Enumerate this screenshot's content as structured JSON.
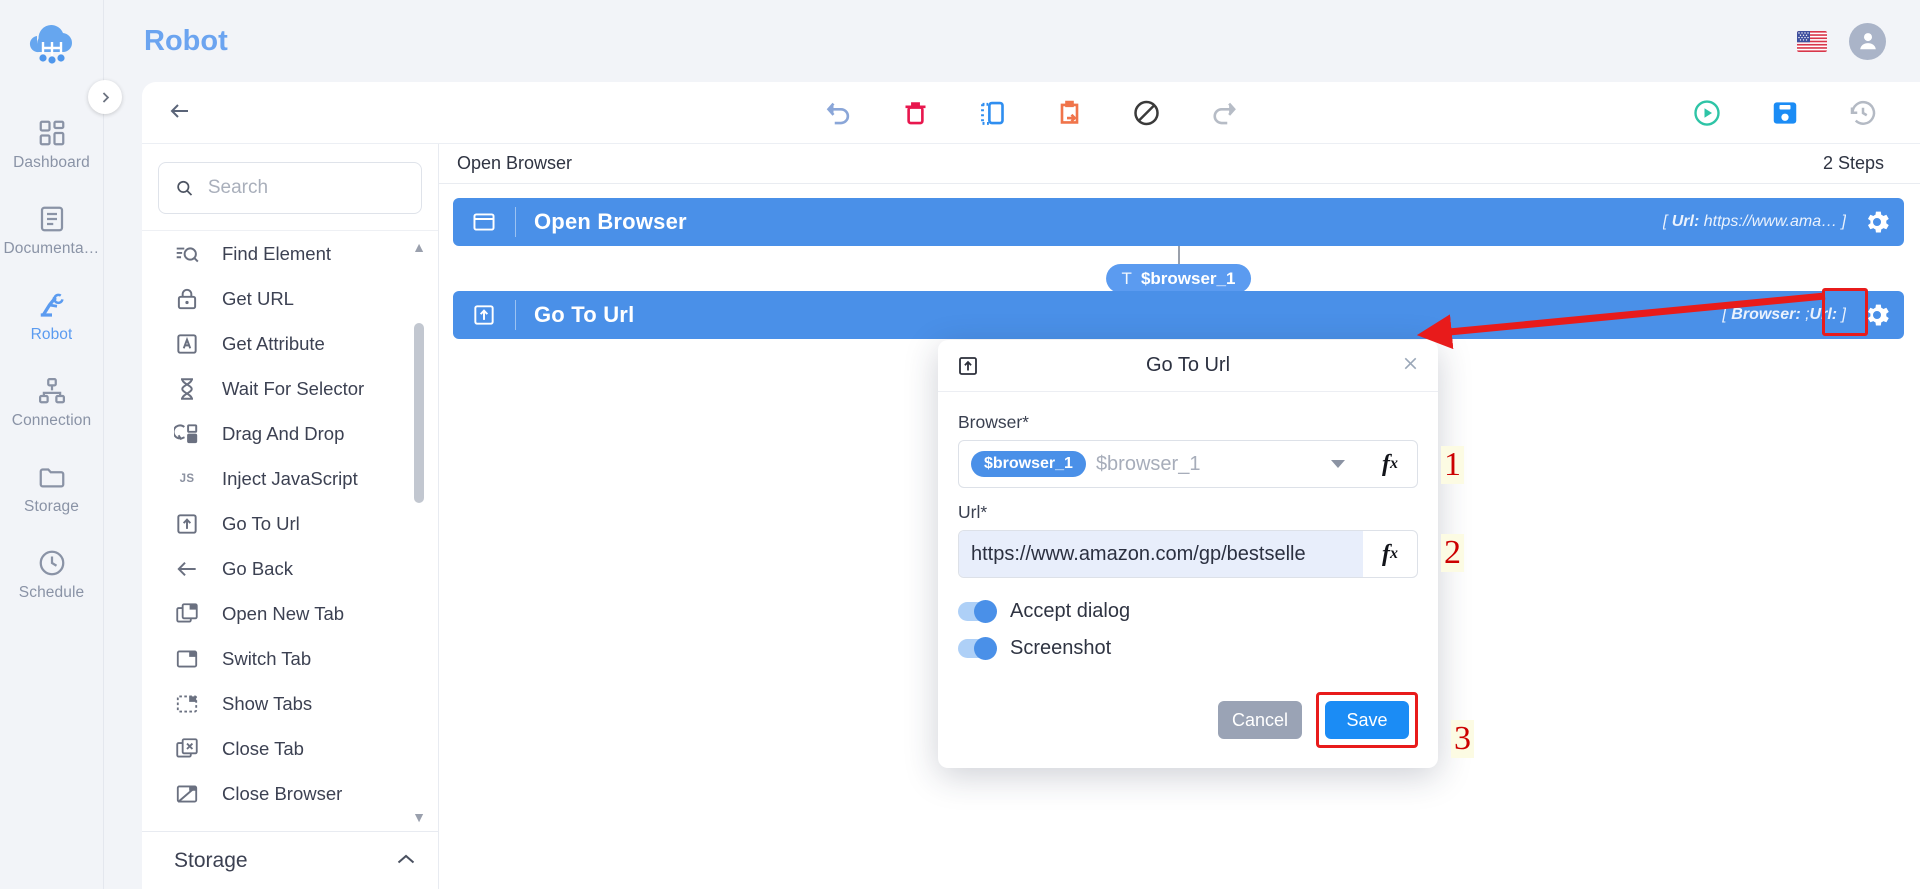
{
  "app": {
    "title": "Robot"
  },
  "rail": {
    "logo_icon": "cloud-robot-logo",
    "expand_icon": "chevron-right-icon",
    "items": [
      {
        "label": "Dashboard",
        "icon": "dashboard-grid-icon",
        "active": false
      },
      {
        "label": "Documentati...",
        "icon": "document-icon",
        "active": false
      },
      {
        "label": "Robot",
        "icon": "robot-arm-icon",
        "active": true
      },
      {
        "label": "Connection",
        "icon": "connection-tree-icon",
        "active": false
      },
      {
        "label": "Storage",
        "icon": "folder-icon",
        "active": false
      },
      {
        "label": "Schedule",
        "icon": "clock-icon",
        "active": false
      }
    ]
  },
  "header": {
    "flag_icon": "us-flag-icon",
    "avatar_icon": "user-avatar-icon"
  },
  "toolbar": {
    "back_icon": "arrow-left-icon",
    "center_actions": [
      {
        "name": "undo",
        "icon": "undo-icon",
        "color": "#8aa6d8"
      },
      {
        "name": "delete",
        "icon": "trash-icon",
        "color": "#e8174e"
      },
      {
        "name": "copy",
        "icon": "copy-dashed-icon",
        "color": "#2f8ef0"
      },
      {
        "name": "paste",
        "icon": "clipboard-arrow-icon",
        "color": "#f0744a"
      },
      {
        "name": "disable",
        "icon": "no-entry-icon",
        "color": "#3a3a3a"
      },
      {
        "name": "redo",
        "icon": "redo-icon",
        "color": "#b6bcc6"
      }
    ],
    "right_actions": [
      {
        "name": "run",
        "icon": "play-circle-icon",
        "color": "#2ec4a6"
      },
      {
        "name": "save",
        "icon": "floppy-save-icon",
        "color": "#1b8cf5"
      },
      {
        "name": "history",
        "icon": "history-clock-icon",
        "color": "#b4bac4"
      }
    ]
  },
  "actions_panel": {
    "search": {
      "placeholder": "Search",
      "value": "",
      "icon": "search-icon"
    },
    "items": [
      {
        "label": "Find Element",
        "icon": "find-element-icon"
      },
      {
        "label": "Get URL",
        "icon": "lock-icon"
      },
      {
        "label": "Get Attribute",
        "icon": "letter-a-box-icon"
      },
      {
        "label": "Wait For Selector",
        "icon": "hourglass-icon"
      },
      {
        "label": "Drag And Drop",
        "icon": "drag-drop-icon"
      },
      {
        "label": "Inject JavaScript",
        "icon": "js-icon"
      },
      {
        "label": "Go To Url",
        "icon": "go-to-url-icon"
      },
      {
        "label": "Go Back",
        "icon": "arrow-left-icon"
      },
      {
        "label": "Open New Tab",
        "icon": "open-new-tab-icon"
      },
      {
        "label": "Switch Tab",
        "icon": "switch-tab-icon"
      },
      {
        "label": "Show Tabs",
        "icon": "show-tabs-icon"
      },
      {
        "label": "Close Tab",
        "icon": "close-tab-icon"
      },
      {
        "label": "Close Browser",
        "icon": "close-browser-icon"
      }
    ],
    "storage_group": {
      "label": "Storage",
      "chevron_icon": "chevron-up-icon"
    }
  },
  "canvas": {
    "breadcrumb": "Open Browser",
    "steps_count": "2 Steps",
    "steps": [
      {
        "title": "Open Browser",
        "icon": "browser-window-icon",
        "meta_prefix": "[ ",
        "meta_key": "Url:",
        "meta_value": " https://www.ama…",
        "meta_suffix": " ]",
        "gear_icon": "gear-icon",
        "highlighted": false
      },
      {
        "title": "Go To Url",
        "icon": "go-to-url-icon",
        "meta_prefix": "[ ",
        "meta_key": "Browser:",
        "meta_value": " ;",
        "meta_key2": "Url:",
        "meta_suffix": " ]",
        "gear_icon": "gear-icon",
        "highlighted": true
      }
    ],
    "variable_chip": {
      "type_glyph": "T",
      "label": "$browser_1"
    }
  },
  "modal": {
    "title": "Go To Url",
    "icon": "go-to-url-icon",
    "close_icon": "close-icon",
    "fields": [
      {
        "label": "Browser*",
        "chip": "$browser_1",
        "value": "$browser_1",
        "dropdown_icon": "chevron-down-icon",
        "fx_icon": "fx-icon"
      },
      {
        "label": "Url*",
        "value": "https://www.amazon.com/gp/bestselle",
        "fx_icon": "fx-icon"
      }
    ],
    "toggles": [
      {
        "label": "Accept dialog",
        "on": true
      },
      {
        "label": "Screenshot",
        "on": true
      }
    ],
    "buttons": {
      "cancel": "Cancel",
      "save": "Save"
    }
  },
  "annotations": {
    "numbers": [
      "1",
      "2",
      "3"
    ],
    "arrow_icon": "red-arrow-icon",
    "accent_red": "#cc0000"
  },
  "colors": {
    "brand_blue": "#4a90e8",
    "title_blue": "#6ba4f0",
    "panel_bg": "#f2f4f8",
    "save_blue": "#1b8cf5",
    "cancel_gray": "#9aa3b5",
    "annotation_red": "#e81b1b"
  }
}
